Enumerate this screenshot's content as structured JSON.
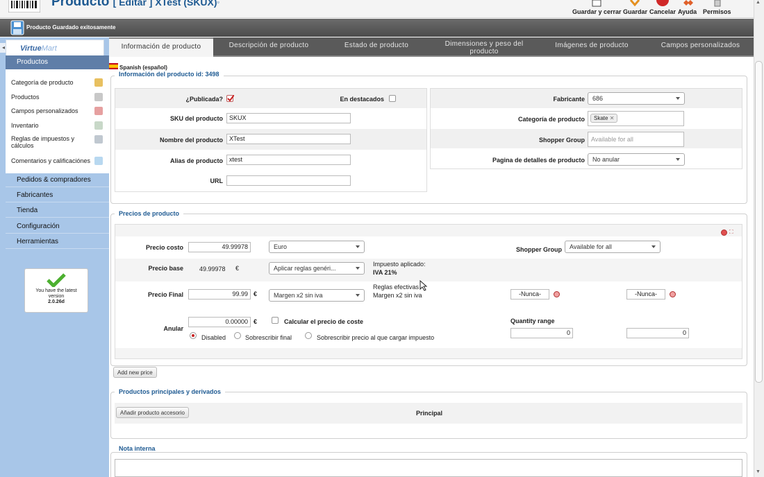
{
  "header": {
    "title": "Producto",
    "subtitle": "[ Editar ] XTest (SKUX)",
    "toolbar": {
      "save_close": "Guardar y cerrar",
      "save": "Guardar",
      "cancel": "Cancelar",
      "help": "Ayuda",
      "permissions": "Permisos"
    }
  },
  "message": {
    "text": "Producto Guardado exitosamente"
  },
  "colors": {
    "accent": "#1e5a92",
    "sidebar": "#a8c6e8",
    "tabbar": "#5a5a5a"
  },
  "tabs": [
    {
      "label": "Información de producto"
    },
    {
      "label": "Descripción de producto"
    },
    {
      "label": "Estado de producto"
    },
    {
      "label": "Dimensiones y peso del producto"
    },
    {
      "label": "Imágenes de producto"
    },
    {
      "label": "Campos personalizados"
    }
  ],
  "sidebar": {
    "logo": {
      "virtue": "Virtue",
      "mart": "Mart"
    },
    "products_header": "Productos",
    "items": [
      {
        "label": "Categoría de producto",
        "icon": "folder-icon"
      },
      {
        "label": "Productos",
        "icon": "product-icon"
      },
      {
        "label": "Campos personalizados",
        "icon": "custom-fields-icon"
      },
      {
        "label": "Inventario",
        "icon": "inventory-icon"
      },
      {
        "label": "Reglas de impuestos y cálculos",
        "icon": "calculator-icon"
      },
      {
        "label": "Comentarios y calificaciónes",
        "icon": "comments-icon"
      }
    ],
    "sections": [
      {
        "label": "Pedidos & compradores"
      },
      {
        "label": "Fabricantes"
      },
      {
        "label": "Tienda"
      },
      {
        "label": "Configuración"
      },
      {
        "label": "Herramientas"
      }
    ],
    "version": {
      "line1": "You have the latest",
      "line2": "version",
      "line3": "2.0.26d"
    }
  },
  "language": "Spanish (español)",
  "product_info": {
    "legend": "Información del producto id: 3498",
    "published_label": "¿Publicada?",
    "published": true,
    "featured_label": "En destacados",
    "featured": false,
    "sku_label": "SKU del producto",
    "sku": "SKUX",
    "name_label": "Nombre del producto",
    "name": "XTest",
    "alias_label": "Alias de producto",
    "alias": "xtest",
    "url_label": "URL",
    "url": "",
    "manufacturer_label": "Fabricante",
    "manufacturer": "686",
    "category_label": "Categoría de producto",
    "category_tag": "Skate",
    "shopper_group_label": "Shopper Group",
    "shopper_group_placeholder": "Available for all",
    "detail_page_label": "Pagina de detalles de producto",
    "detail_page": "No anular"
  },
  "prices": {
    "legend": "Precios de producto",
    "cost_label": "Precio costo",
    "cost": "49.99978",
    "currency": "Euro",
    "shopper_group_label": "Shopper Group",
    "shopper_group": "Available for all",
    "base_label": "Precio base",
    "base": "49.99978",
    "euro_sign": "€",
    "rules_select": "Aplicar reglas genéri...",
    "tax_applied_label": "Impuesto aplicado:",
    "tax_applied": "IVA 21%",
    "final_label": "Precio Final",
    "final": "99.99",
    "margin_select": "Margen x2 sin iva",
    "effective_rules_label": "Reglas efectivas",
    "effective_rules": "Margen x2 sin iva",
    "never1": "-Nunca-",
    "never2": "-Nunca-",
    "override_label": "Anular",
    "override": "0.00000",
    "calc_cost_label": "Calcular el precio de coste",
    "disabled_label": "Disabled",
    "override_final_label": "Sobrescribir final",
    "override_tax_label": "Sobrescribir precio al que cargar impuesto",
    "quantity_label": "Quantity range",
    "qty_from": "0",
    "qty_to": "0",
    "add_price": "Add new price"
  },
  "related": {
    "legend": "Productos principales y derivados",
    "add_accessory": "Añadir producto accesorio",
    "principal": "Principal"
  },
  "notes": {
    "legend": "Nota interna"
  }
}
